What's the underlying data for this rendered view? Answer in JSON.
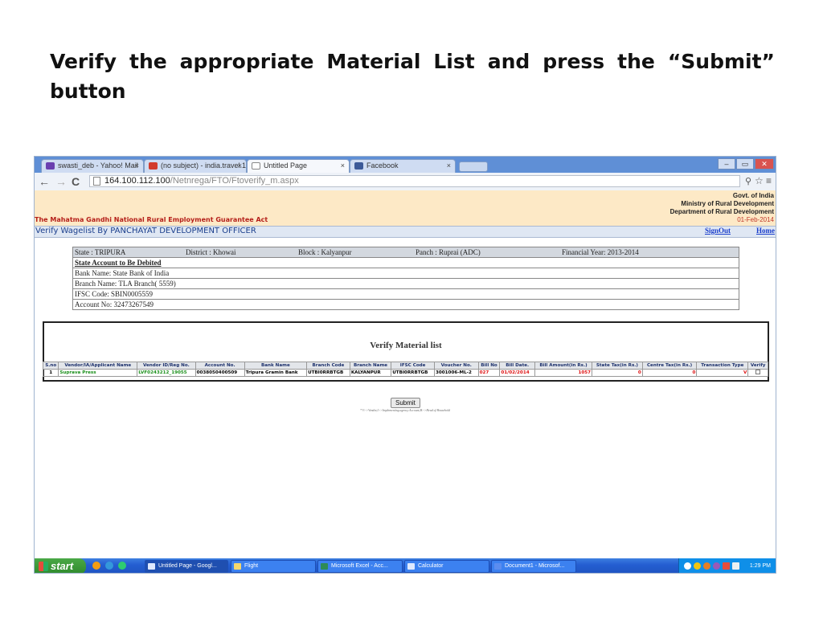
{
  "slide": {
    "title": "Verify the appropriate Material List and press the “Submit” button"
  },
  "browser": {
    "tabs": [
      {
        "label": "swasti_deb - Yahoo! Mail",
        "icon": "mail-icon",
        "color": "#6a3fb0"
      },
      {
        "label": "(no subject) - india.travel.1!",
        "icon": "gmail-icon",
        "color": "#d23a2c"
      },
      {
        "label": "Untitled Page",
        "icon": "page-icon",
        "color": "#ffffff"
      },
      {
        "label": "Facebook",
        "icon": "facebook-icon",
        "color": "#3b5998"
      }
    ],
    "close_glyph": "×",
    "url_host": "164.100.112.100",
    "url_path": "/Netnrega/FTO/Ftoverify_m.aspx"
  },
  "header": {
    "govt_lines": [
      "Govt. of India",
      "Ministry of Rural Development",
      "Department of Rural Development"
    ],
    "date": "01-Feb-2014",
    "scheme": "The Mahatma Gandhi National Rural Employment Guarantee Act",
    "page_title": "Verify Wagelist By PANCHAYAT DEVELOPMENT OFFICER",
    "signout": "SignOut",
    "home": "Home"
  },
  "info": {
    "state": "State : TRIPURA",
    "district": "District : Khowai",
    "block": "Block : Kalyanpur",
    "panch": "Panch : Ruprai (ADC)",
    "fy": "Financial Year: 2013-2014",
    "account_heading": "State Account to Be Debited",
    "bank": "Bank Name: State Bank of India",
    "branch": "Branch Name: TLA Branch( 5559)",
    "ifsc": "IFSC Code: SBIN0005559",
    "account": "Account No: 32473267549"
  },
  "material": {
    "title": "Verify Material list",
    "columns": [
      "S.no",
      "Vendor/IA/Applicant Name",
      "Vendor ID/Reg No.",
      "Account No.",
      "Bank Name",
      "Branch Code",
      "Branch Name",
      "IFSC Code",
      "Voucher No.",
      "Bill No",
      "Bill Date.",
      "Bill Amount(in Rs.)",
      "State Tax(in Rs.)",
      "Centre Tax(in Rs.)",
      "Transaction Type",
      "Verify"
    ],
    "row": {
      "sno": "1",
      "vendor": "Suprava Press",
      "vendor_id": "LVF0243212_19055",
      "account": "0038050400509",
      "bank": "Tripura Gramin Bank",
      "branch_code": "UTBI0RRBTGB",
      "branch_name": "KALYANPUR",
      "ifsc": "UTBI0RRBTGB",
      "voucher": "3001006-ML-2",
      "bill_no": "027",
      "bill_date": "01/02/2014",
      "amount": "1057",
      "state_tax": "0",
      "centre_tax": "0",
      "txn_type": "V",
      "verify_checked": false
    },
    "submit_label": "Submit",
    "legend": "* V:->Vendor,I:->Implementing agency Account,H:->Head of Household"
  },
  "taskbar": {
    "start": "start",
    "tasks": [
      "Untitled Page - Googl...",
      "Flight",
      "Microsoft Excel - Acc...",
      "Calculator",
      "Document1 - Microsof..."
    ],
    "clock": "1:29 PM"
  }
}
